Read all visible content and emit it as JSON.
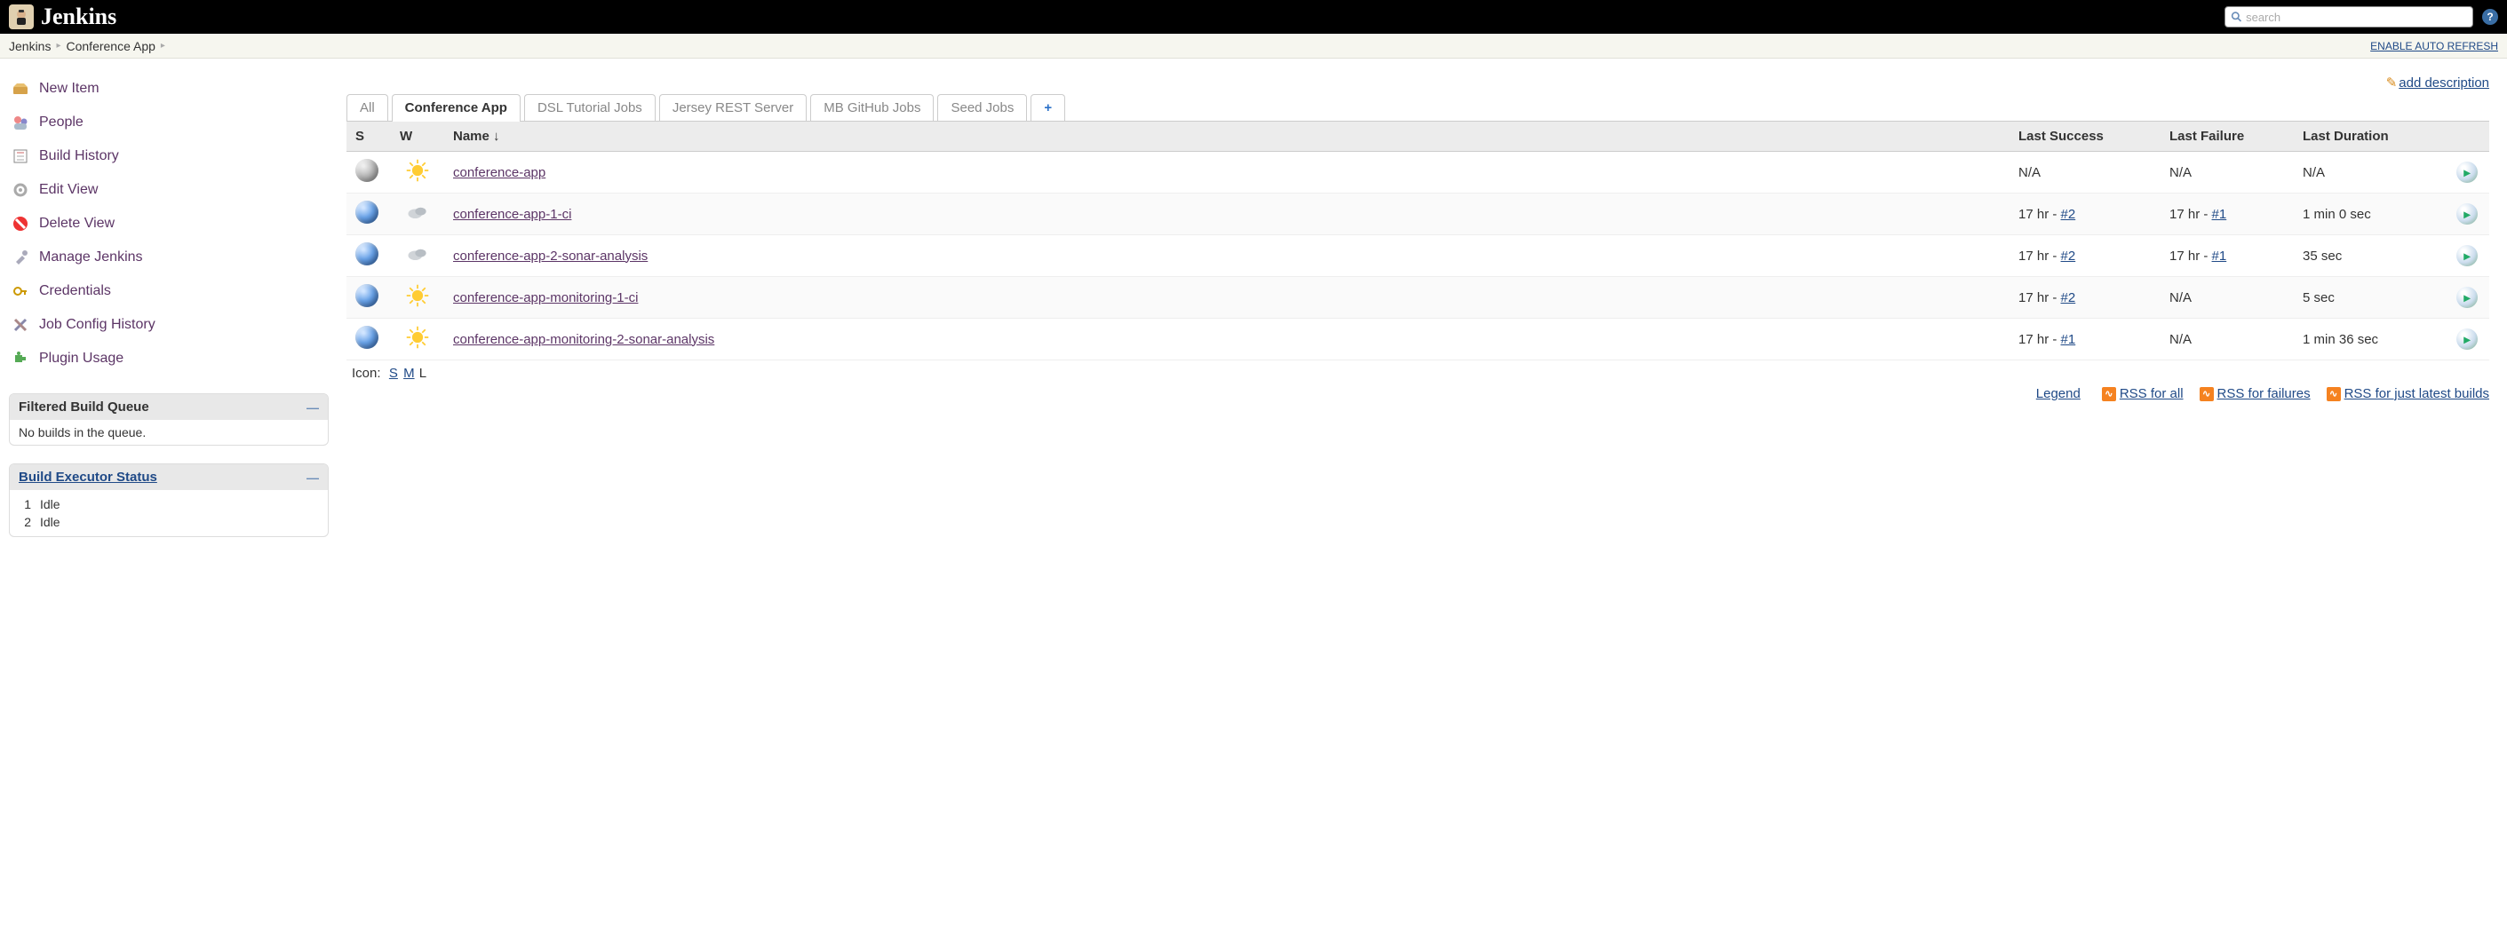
{
  "header": {
    "app_name": "Jenkins",
    "search_placeholder": "search"
  },
  "breadcrumb": {
    "items": [
      "Jenkins",
      "Conference App"
    ],
    "auto_refresh_label": "ENABLE AUTO REFRESH"
  },
  "sidebar": {
    "tasks": [
      {
        "label": "New Item",
        "icon": "new-item"
      },
      {
        "label": "People",
        "icon": "people"
      },
      {
        "label": "Build History",
        "icon": "build-history"
      },
      {
        "label": "Edit View",
        "icon": "edit-view"
      },
      {
        "label": "Delete View",
        "icon": "delete-view"
      },
      {
        "label": "Manage Jenkins",
        "icon": "manage"
      },
      {
        "label": "Credentials",
        "icon": "credentials"
      },
      {
        "label": "Job Config History",
        "icon": "job-config"
      },
      {
        "label": "Plugin Usage",
        "icon": "plugin"
      }
    ],
    "queue_pane": {
      "title": "Filtered Build Queue",
      "body": "No builds in the queue."
    },
    "executor_pane": {
      "title": "Build Executor Status",
      "executors": [
        {
          "num": "1",
          "status": "Idle"
        },
        {
          "num": "2",
          "status": "Idle"
        }
      ]
    }
  },
  "main": {
    "add_description_label": "add description",
    "tabs": [
      {
        "label": "All",
        "active": false
      },
      {
        "label": "Conference App",
        "active": true
      },
      {
        "label": "DSL Tutorial Jobs",
        "active": false
      },
      {
        "label": "Jersey REST Server",
        "active": false
      },
      {
        "label": "MB GitHub Jobs",
        "active": false
      },
      {
        "label": "Seed Jobs",
        "active": false
      }
    ],
    "columns": {
      "s": "S",
      "w": "W",
      "name": "Name  ↓",
      "last_success": "Last Success",
      "last_failure": "Last Failure",
      "last_duration": "Last Duration"
    },
    "jobs": [
      {
        "status": "grey",
        "weather": "sun",
        "name": "conference-app",
        "last_success_text": "N/A",
        "last_success_link": "",
        "last_failure_text": "N/A",
        "last_failure_link": "",
        "last_duration": "N/A"
      },
      {
        "status": "blue",
        "weather": "cloud",
        "name": "conference-app-1-ci",
        "last_success_text": "17 hr - ",
        "last_success_link": "#2",
        "last_failure_text": "17 hr - ",
        "last_failure_link": "#1",
        "last_duration": "1 min 0 sec"
      },
      {
        "status": "blue",
        "weather": "cloud",
        "name": "conference-app-2-sonar-analysis",
        "last_success_text": "17 hr - ",
        "last_success_link": "#2",
        "last_failure_text": "17 hr - ",
        "last_failure_link": "#1",
        "last_duration": "35 sec"
      },
      {
        "status": "blue",
        "weather": "sun",
        "name": "conference-app-monitoring-1-ci",
        "last_success_text": "17 hr - ",
        "last_success_link": "#2",
        "last_failure_text": "N/A",
        "last_failure_link": "",
        "last_duration": "5 sec"
      },
      {
        "status": "blue",
        "weather": "sun",
        "name": "conference-app-monitoring-2-sonar-analysis",
        "last_success_text": "17 hr - ",
        "last_success_link": "#1",
        "last_failure_text": "N/A",
        "last_failure_link": "",
        "last_duration": "1 min 36 sec"
      }
    ],
    "icon_size": {
      "label": "Icon:",
      "options": [
        "S",
        "M",
        "L"
      ],
      "current": "L"
    },
    "footer_links": {
      "legend": "Legend",
      "rss_all": "RSS for all",
      "rss_failures": "RSS for failures",
      "rss_latest": "RSS for just latest builds"
    }
  }
}
